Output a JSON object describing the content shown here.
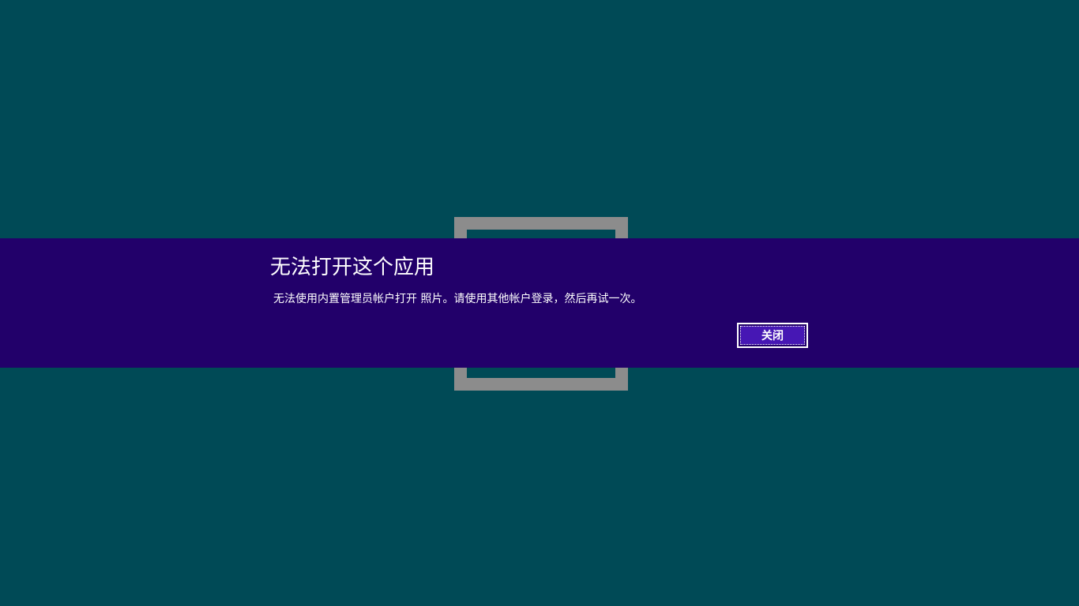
{
  "screen": {
    "background_color": "#004a56"
  },
  "splash": {
    "app_name": "照片",
    "tile_icon": "photos-app-tile-icon",
    "tile_color": "#8c8c8c"
  },
  "dialog": {
    "title": "无法打开这个应用",
    "message": "无法使用内置管理员帐户打开 照片。请使用其他帐户登录，然后再试一次。",
    "close_label": "关闭",
    "band_color": "#22006a",
    "button_color": "#4617b4"
  }
}
